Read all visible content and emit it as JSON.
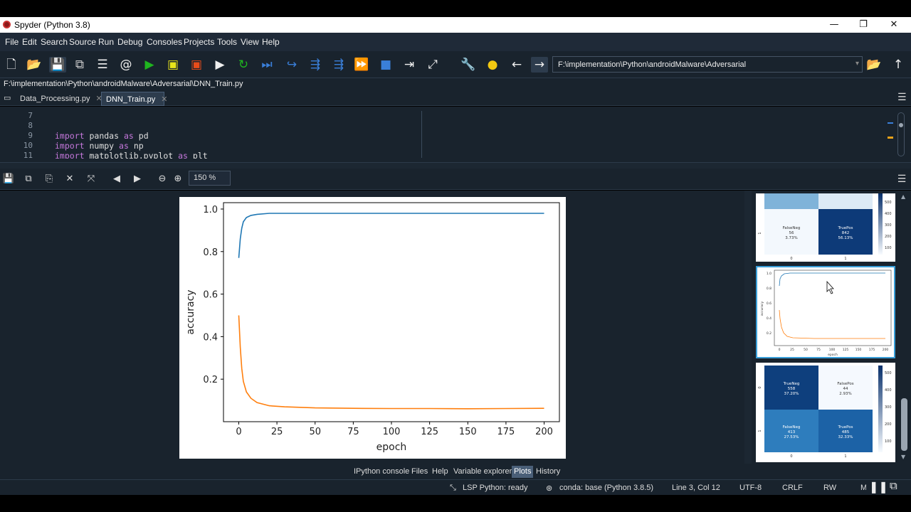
{
  "window": {
    "title": "Spyder (Python 3.8)",
    "minimize": "—",
    "maximize": "❐",
    "close": "✕"
  },
  "menu": [
    "File",
    "Edit",
    "Search",
    "Source",
    "Run",
    "Debug",
    "Consoles",
    "Projects",
    "Tools",
    "View",
    "Help"
  ],
  "toolbar": {
    "path": "F:\\implementation\\Python\\androidMalware\\Adversarial"
  },
  "editor": {
    "file_path": "F:\\implementation\\Python\\androidMalware\\Adversarial\\DNN_Train.py",
    "tabs": [
      {
        "label": "Data_Processing.py"
      },
      {
        "label": "DNN_Train.py",
        "active": true
      }
    ],
    "lines": [
      {
        "num": "7",
        "text": ""
      },
      {
        "num": "8",
        "text": ""
      },
      {
        "num": "9",
        "text": "import pandas as pd"
      },
      {
        "num": "10",
        "text": "import numpy as np"
      },
      {
        "num": "11",
        "text": "import matplotlib.pyplot as plt"
      }
    ]
  },
  "plots": {
    "zoom": "150 %"
  },
  "chart_data": {
    "type": "line",
    "xlabel": "epoch",
    "ylabel": "accuracy",
    "xlim": [
      -10,
      210
    ],
    "ylim": [
      0.0,
      1.03
    ],
    "xticks": [
      "0",
      "25",
      "50",
      "75",
      "100",
      "125",
      "150",
      "175",
      "200"
    ],
    "yticks": [
      "0.2",
      "0.4",
      "0.6",
      "0.8",
      "1.0"
    ],
    "series": [
      {
        "color": "#1f77b4",
        "x": [
          0,
          1,
          2,
          3,
          5,
          8,
          12,
          20,
          30,
          50,
          75,
          100,
          125,
          150,
          175,
          200
        ],
        "y": [
          0.77,
          0.86,
          0.91,
          0.94,
          0.96,
          0.97,
          0.975,
          0.98,
          0.98,
          0.98,
          0.98,
          0.98,
          0.98,
          0.98,
          0.98,
          0.98
        ]
      },
      {
        "color": "#ff7f0e",
        "x": [
          0,
          1,
          2,
          3,
          5,
          8,
          12,
          20,
          30,
          50,
          75,
          100,
          125,
          150,
          175,
          200
        ],
        "y": [
          0.5,
          0.35,
          0.25,
          0.19,
          0.14,
          0.11,
          0.09,
          0.075,
          0.07,
          0.065,
          0.063,
          0.062,
          0.062,
          0.061,
          0.062,
          0.063
        ]
      }
    ]
  },
  "thumbnails": {
    "cm1": {
      "cells": [
        {
          "label": "FalseNeg",
          "count": "56",
          "pct": "3.73%"
        },
        {
          "label": "TruePos",
          "count": "842",
          "pct": "56.13%"
        }
      ],
      "cbar": [
        "500",
        "400",
        "300",
        "200",
        "100"
      ],
      "xticks": [
        "0",
        "1"
      ],
      "yticks": [
        "1"
      ]
    },
    "plot": {
      "yticks": [
        "1.0",
        "0.8",
        "0.6",
        "0.4",
        "0.2"
      ],
      "xticks": [
        "0",
        "25",
        "50",
        "75",
        "100",
        "125",
        "150",
        "175",
        "200"
      ],
      "xlabel": "epoch",
      "ylabel": "accuracy"
    },
    "cm2": {
      "cells": [
        {
          "label": "TrueNeg",
          "count": "558",
          "pct": "37.20%"
        },
        {
          "label": "FalsePos",
          "count": "44",
          "pct": "2.93%"
        },
        {
          "label": "FalseNeg",
          "count": "413",
          "pct": "27.53%"
        },
        {
          "label": "TruePos",
          "count": "485",
          "pct": "32.33%"
        }
      ],
      "cbar": [
        "500",
        "400",
        "300",
        "200",
        "100"
      ],
      "xticks": [
        "0",
        "1"
      ],
      "yticks": [
        "0",
        "1"
      ]
    }
  },
  "bottom_tabs": [
    "IPython console",
    "Files",
    "Help",
    "Variable explorer",
    "Plots",
    "History"
  ],
  "active_bottom_tab": "Plots",
  "status": {
    "lsp": "LSP Python: ready",
    "conda": "conda: base (Python 3.8.5)",
    "position": "Line 3, Col 12",
    "encoding": "UTF-8",
    "eol": "CRLF",
    "mode": "RW",
    "mem": "M"
  }
}
